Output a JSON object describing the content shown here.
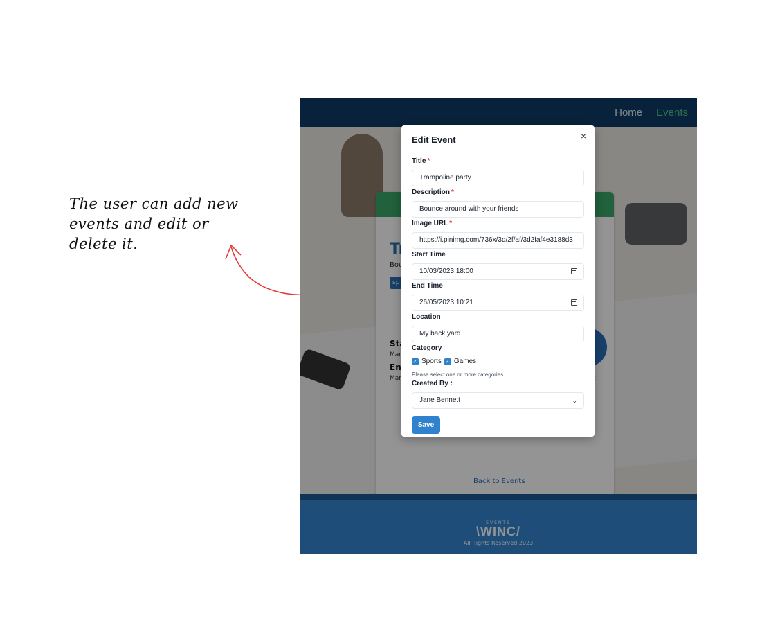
{
  "annotation": {
    "lines": [
      "The user can add new",
      "events and  edit or",
      "delete it."
    ]
  },
  "navbar": {
    "links": [
      "Home",
      "Events"
    ],
    "active": "Events"
  },
  "background_card": {
    "title_fragment": "Tr",
    "desc_fragment": "Bou",
    "tag_fragment": "sp",
    "start_fragment": "Sta",
    "start_value_fragment": "Mar",
    "end_fragment": "End",
    "end_value_fragment": "Mar",
    "trailing_fragment": "t",
    "back_link": "Back to Events"
  },
  "footer": {
    "logo_small": "EVENTS",
    "logo": "\\WINC/",
    "copyright": "All Rights Reserved 2023"
  },
  "modal": {
    "title": "Edit Event",
    "close_icon": "×",
    "fields": {
      "title_label": "Title",
      "title_value": "Trampoline party",
      "description_label": "Description",
      "description_value": "Bounce around with your friends",
      "image_label": "Image URL",
      "image_value": "https://i.pinimg.com/736x/3d/2f/af/3d2faf4e3188d3",
      "start_label": "Start Time",
      "start_value": "10/03/2023 18:00",
      "end_label": "End Time",
      "end_value": "26/05/2023 10:21",
      "location_label": "Location",
      "location_value": "My back yard",
      "category_label": "Category",
      "categories": [
        "Sports",
        "Games"
      ],
      "category_helper": "Please select one or more categories.",
      "created_by_label": "Created By :",
      "created_by_value": "Jane Bennett"
    },
    "required_mark": "*",
    "save_label": "Save"
  },
  "colors": {
    "navbar": "#0d3c64",
    "nav_active": "#4ec38a",
    "primary": "#3182ce",
    "footer": "#3586d1",
    "arrow": "#e53935"
  }
}
